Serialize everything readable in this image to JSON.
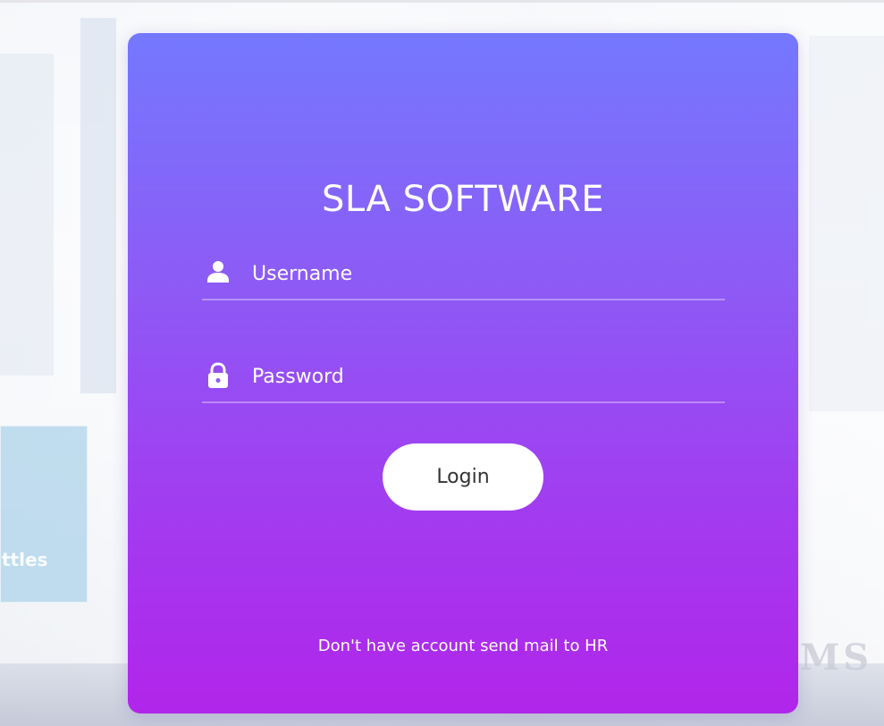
{
  "app": {
    "title": "SLA SOFTWARE"
  },
  "login_form": {
    "username": {
      "placeholder": "Username",
      "value": "",
      "icon": "user-icon"
    },
    "password": {
      "placeholder": "Password",
      "value": "",
      "icon": "lock-icon"
    },
    "submit_label": "Login",
    "footer_note": "Don't have account send mail to HR"
  },
  "colors": {
    "card_gradient_top": "#7478ff",
    "card_gradient_bottom": "#b125ea",
    "button_background": "#ffffff",
    "button_text": "#333333",
    "text": "#ffffff"
  }
}
